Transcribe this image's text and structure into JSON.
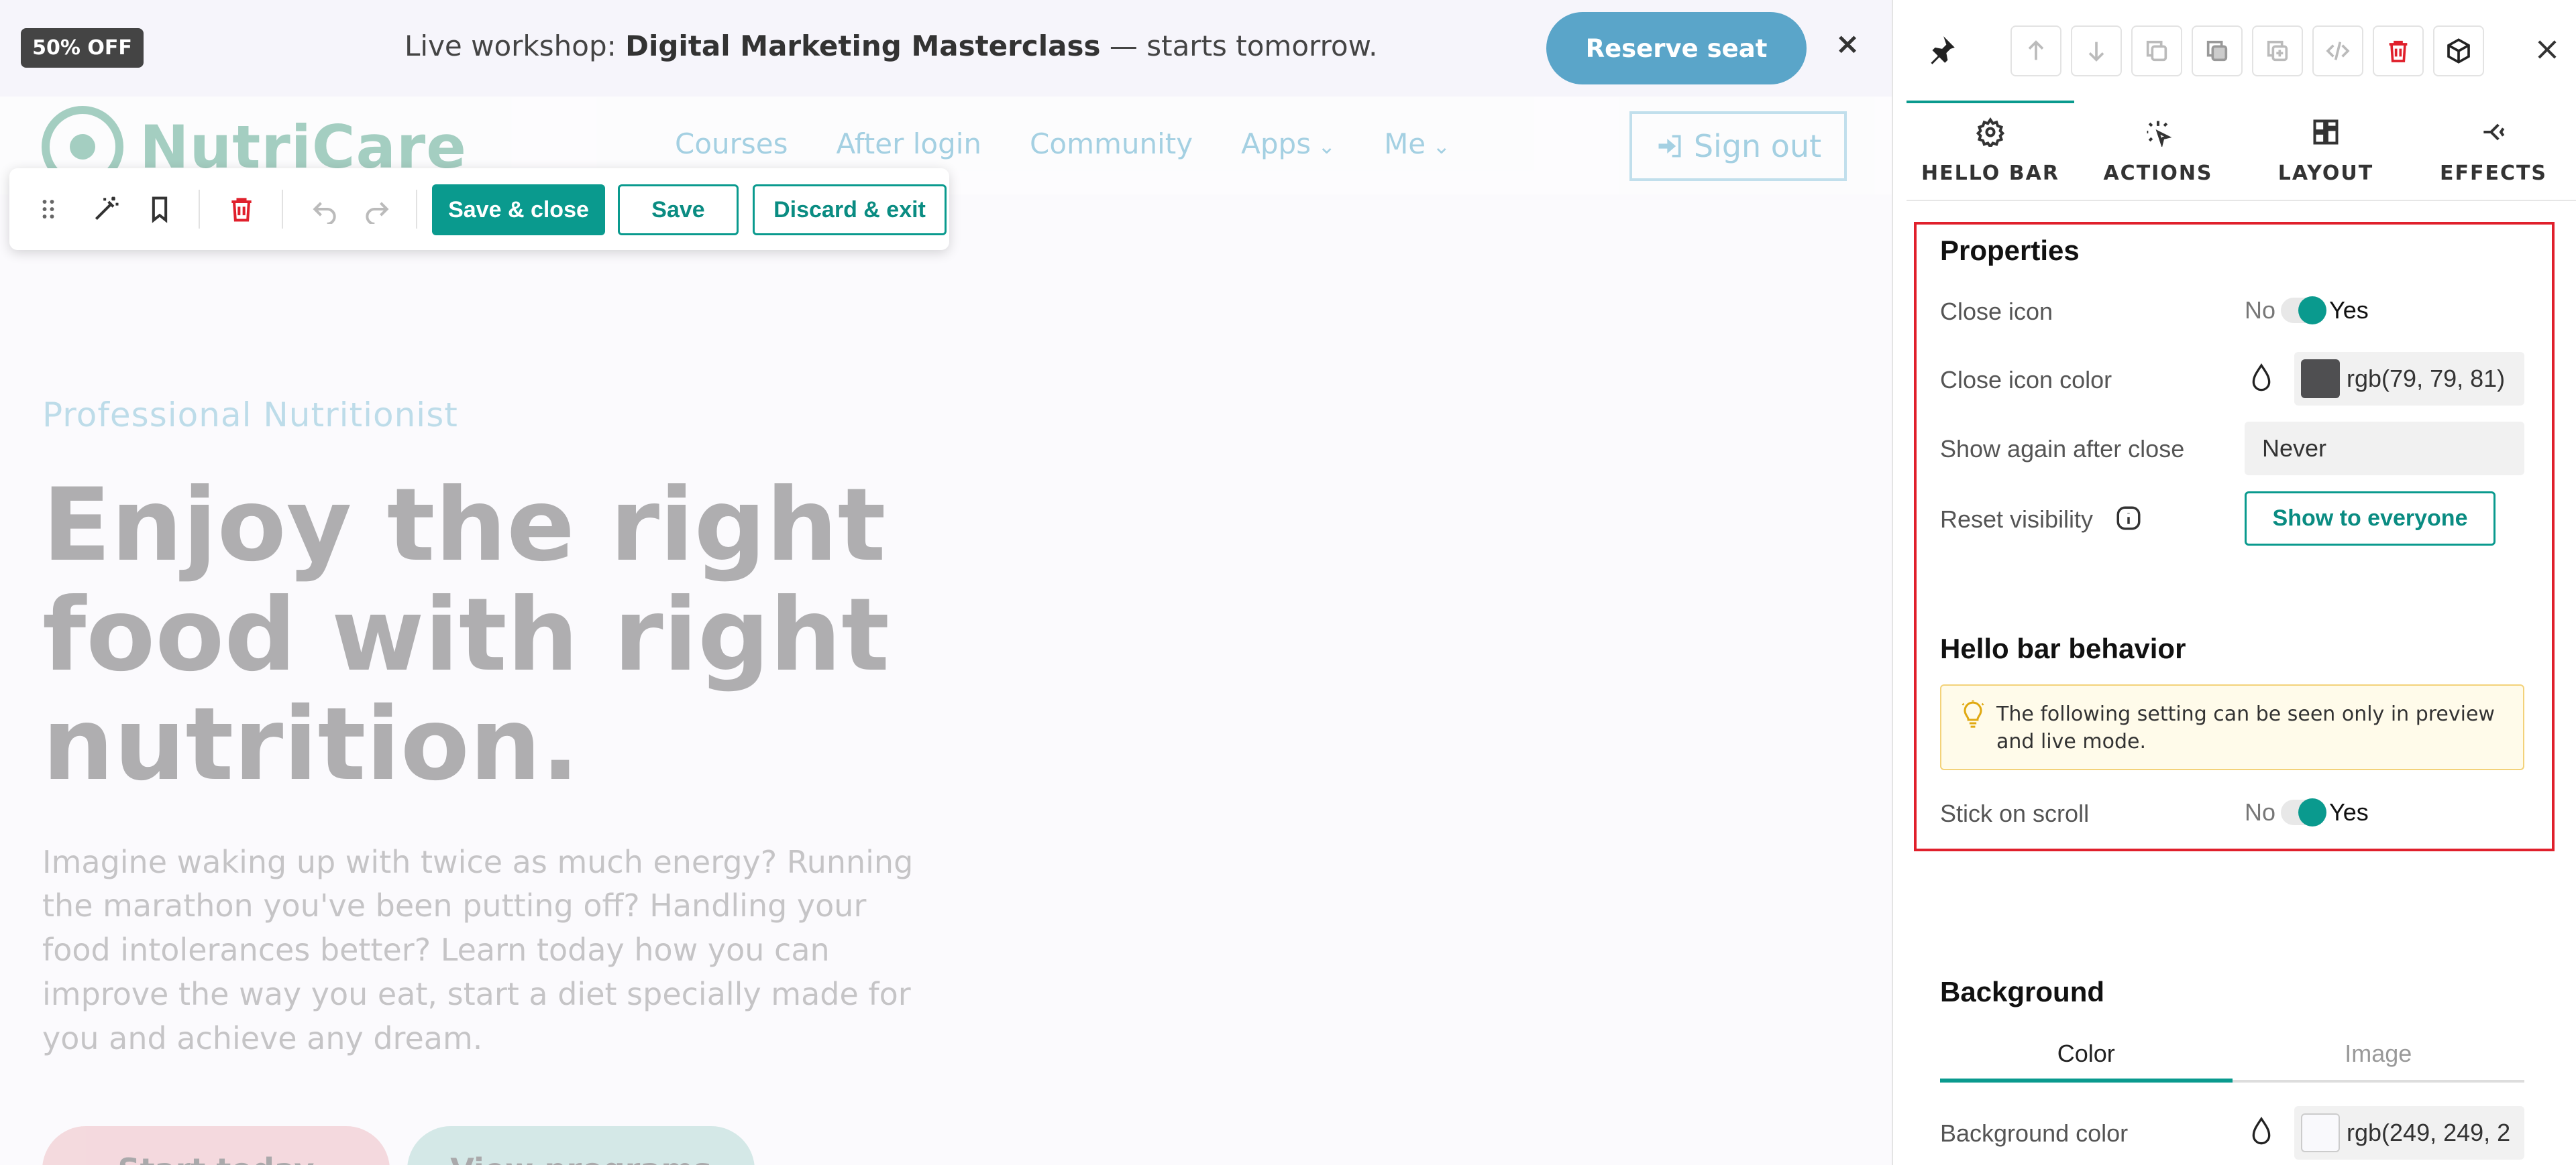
{
  "hello_bar": {
    "badge": "50% OFF",
    "message_prefix": "Live workshop: ",
    "message_bold": "Digital Marketing Masterclass",
    "message_suffix": " — starts tomorrow.",
    "cta": "Reserve seat",
    "close_glyph": "×"
  },
  "site": {
    "logo": "NutriCare",
    "menu": [
      "Courses",
      "After login",
      "Community",
      "Apps",
      "Me"
    ],
    "signout": "Sign out",
    "hero": {
      "eyebrow": "Professional Nutritionist",
      "title": "Enjoy the right food with right nutrition.",
      "description": "Imagine waking up with twice as much energy? Running the marathon you've been putting off? Handling your food intolerances better? Learn today how you can improve the way you eat, start a diet specially made for you and achieve any dream.",
      "cta_start": "Start today",
      "cta_view": "View programs"
    }
  },
  "editor_toolbar": {
    "save_close": "Save & close",
    "save": "Save",
    "discard": "Discard & exit"
  },
  "sidebar": {
    "close_glyph": "×",
    "tabs": [
      {
        "label": "HELLO BAR",
        "icon": "gear-icon",
        "active": true
      },
      {
        "label": "ACTIONS",
        "icon": "cursor-click-icon"
      },
      {
        "label": "LAYOUT",
        "icon": "layout-icon"
      },
      {
        "label": "EFFECTS",
        "icon": "effects-icon"
      }
    ],
    "properties": {
      "title": "Properties",
      "close_icon_label": "Close icon",
      "close_icon_no": "No",
      "close_icon_yes": "Yes",
      "close_icon_color_label": "Close icon color",
      "close_icon_color_value": "rgb(79, 79, 81)",
      "close_icon_color_hex": "#4f4f51",
      "show_again_label": "Show again after close",
      "show_again_value": "Never",
      "reset_visibility_label": "Reset visibility",
      "reset_visibility_button": "Show to everyone"
    },
    "behavior": {
      "title": "Hello bar behavior",
      "notice": "The following setting can be seen only in preview and live mode.",
      "stick_label": "Stick on scroll",
      "stick_no": "No",
      "stick_yes": "Yes"
    },
    "background": {
      "title": "Background",
      "tab_color": "Color",
      "tab_image": "Image",
      "color_label": "Background color",
      "color_value": "rgb(249, 249, 2",
      "color_hex": "#f9f9fc"
    }
  },
  "colors": {
    "accent": "#0a9a8e",
    "hello_bar_cta": "#5aa5c9",
    "danger": "#e0202c"
  }
}
